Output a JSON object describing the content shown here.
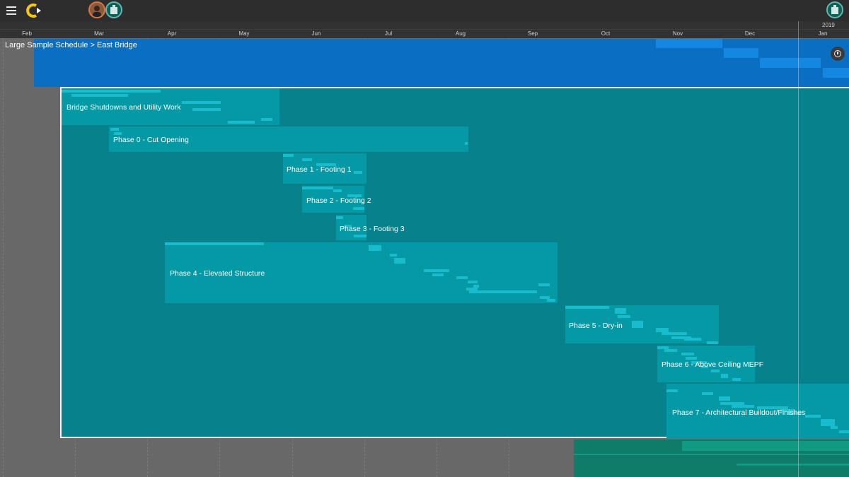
{
  "header": {
    "menu_icon": "hamburger-menu-icon",
    "logo_icon": "app-logo-icon",
    "avatars": [
      "user-avatar",
      "team-avatar"
    ],
    "right_avatar": "team-avatar"
  },
  "timeline": {
    "year": "2019",
    "months": [
      "Feb",
      "Mar",
      "Apr",
      "May",
      "Jun",
      "Jul",
      "Aug",
      "Sep",
      "Oct",
      "Nov",
      "Dec",
      "Jan"
    ]
  },
  "breadcrumb": "Large Sample Schedule > East Bridge",
  "info_icon": "info-icon",
  "colors": {
    "top_block": "#0a6fc2",
    "container": "#07818b",
    "phase": "#0598a5",
    "task_bar": "#18bccd",
    "bottom_block": "#0f7c6a"
  },
  "phases": [
    "Bridge Shutdowns and Utility Work",
    "Phase 0 - Cut Opening",
    "Phase 1 - Footing 1",
    "Phase 2 - Footing 2",
    "Phase 3 - Footing 3",
    "Phase 4 - Elevated Structure",
    "Phase 5 - Dry-in",
    "Phase 6 - Above Ceiling MEPF",
    "Phase 7 - Architectural Buildout/Finishes"
  ]
}
